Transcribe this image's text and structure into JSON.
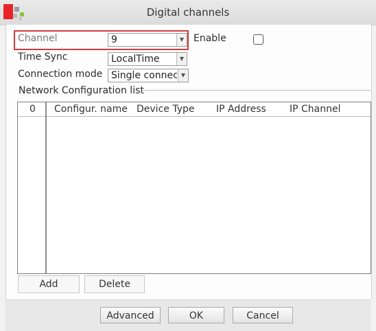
{
  "window": {
    "title": "Digital channels"
  },
  "colors": {
    "accent_red": "#d23c3c",
    "logo_red": "#e8232a",
    "logo_green": "#8cc63f",
    "logo_gray": "#9e9e9e"
  },
  "form": {
    "channel": {
      "label": "Channel",
      "value": "9"
    },
    "enable": {
      "label": "Enable",
      "checked": false
    },
    "time_sync": {
      "label": "Time Sync",
      "value": "LocalTime"
    },
    "connection_mode": {
      "label": "Connection mode",
      "value": "Single connec"
    }
  },
  "network_list": {
    "legend": "Network Configuration list",
    "columns": [
      "0",
      "Configur. name",
      "Device Type",
      "IP Address",
      "IP Channel"
    ],
    "rows": []
  },
  "list_actions": {
    "add": "Add",
    "delete": "Delete"
  },
  "buttons": {
    "advanced": "Advanced",
    "ok": "OK",
    "cancel": "Cancel"
  },
  "icons": [
    "logo-icon",
    "dropdown-arrow-icon",
    "checkbox-icon"
  ]
}
